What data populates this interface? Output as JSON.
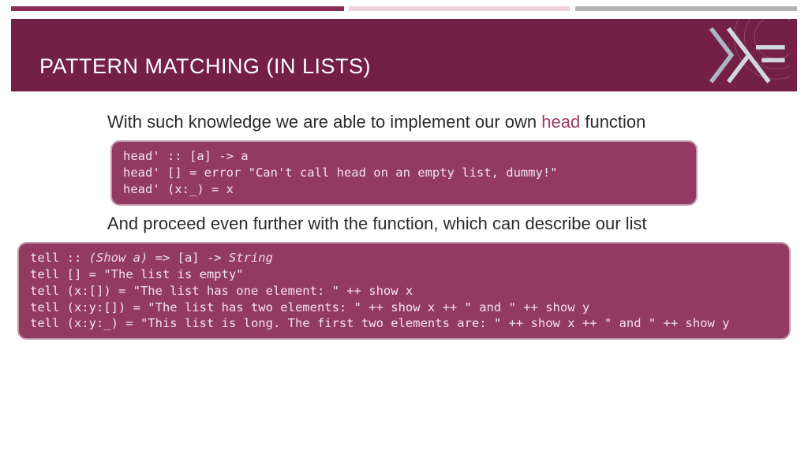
{
  "banner": {
    "title": "PATTERN MATCHING (IN LISTS)"
  },
  "intro": {
    "pre": "With such knowledge we are able to implement our own ",
    "kw": "head",
    "post": " function"
  },
  "code1": {
    "l1": "head' :: [a] -> a",
    "l2": "head' [] = error \"Can't call head on an empty list, dummy!\"",
    "l3": "head' (x:_) = x"
  },
  "mid": "And proceed even further with the function, which can describe our list",
  "code2": {
    "sig_pre": "tell :: ",
    "sig_em": "(Show a)",
    "sig_mid": " => [a] -> ",
    "sig_em2": "String",
    "l2": "tell [] = \"The list is empty\"",
    "l3": "tell (x:[]) = \"The list has one element: \" ++ show x",
    "l4": "tell (x:y:[]) = \"The list has two elements: \" ++ show x ++ \" and \" ++ show y",
    "l5": "tell (x:y:_) = \"This list is long. The first two elements are: \" ++ show x ++ \" and \" ++ show y"
  }
}
